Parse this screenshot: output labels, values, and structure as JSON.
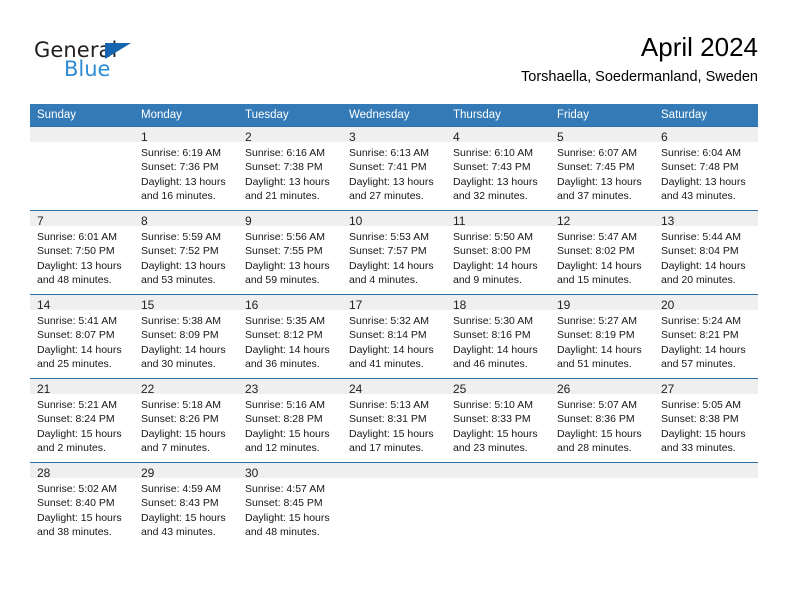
{
  "logo": {
    "word1": "General",
    "word2": "Blue",
    "triangle_color": "#1565b0",
    "word2_color": "#2e8bd4"
  },
  "header": {
    "title": "April 2024",
    "subtitle": "Torshaella, Soedermanland, Sweden"
  },
  "theme": {
    "header_bg": "#337ab7",
    "row_divider": "#2f6fa8",
    "daynum_bg": "#efefef"
  },
  "weekday_headers": [
    "Sunday",
    "Monday",
    "Tuesday",
    "Wednesday",
    "Thursday",
    "Friday",
    "Saturday"
  ],
  "weeks": [
    [
      {
        "day": "",
        "blank": true,
        "sunrise": "",
        "sunset": "",
        "daylight1": "",
        "daylight2": ""
      },
      {
        "day": "1",
        "blank": false,
        "sunrise": "Sunrise: 6:19 AM",
        "sunset": "Sunset: 7:36 PM",
        "daylight1": "Daylight: 13 hours",
        "daylight2": "and 16 minutes."
      },
      {
        "day": "2",
        "blank": false,
        "sunrise": "Sunrise: 6:16 AM",
        "sunset": "Sunset: 7:38 PM",
        "daylight1": "Daylight: 13 hours",
        "daylight2": "and 21 minutes."
      },
      {
        "day": "3",
        "blank": false,
        "sunrise": "Sunrise: 6:13 AM",
        "sunset": "Sunset: 7:41 PM",
        "daylight1": "Daylight: 13 hours",
        "daylight2": "and 27 minutes."
      },
      {
        "day": "4",
        "blank": false,
        "sunrise": "Sunrise: 6:10 AM",
        "sunset": "Sunset: 7:43 PM",
        "daylight1": "Daylight: 13 hours",
        "daylight2": "and 32 minutes."
      },
      {
        "day": "5",
        "blank": false,
        "sunrise": "Sunrise: 6:07 AM",
        "sunset": "Sunset: 7:45 PM",
        "daylight1": "Daylight: 13 hours",
        "daylight2": "and 37 minutes."
      },
      {
        "day": "6",
        "blank": false,
        "sunrise": "Sunrise: 6:04 AM",
        "sunset": "Sunset: 7:48 PM",
        "daylight1": "Daylight: 13 hours",
        "daylight2": "and 43 minutes."
      }
    ],
    [
      {
        "day": "7",
        "blank": false,
        "sunrise": "Sunrise: 6:01 AM",
        "sunset": "Sunset: 7:50 PM",
        "daylight1": "Daylight: 13 hours",
        "daylight2": "and 48 minutes."
      },
      {
        "day": "8",
        "blank": false,
        "sunrise": "Sunrise: 5:59 AM",
        "sunset": "Sunset: 7:52 PM",
        "daylight1": "Daylight: 13 hours",
        "daylight2": "and 53 minutes."
      },
      {
        "day": "9",
        "blank": false,
        "sunrise": "Sunrise: 5:56 AM",
        "sunset": "Sunset: 7:55 PM",
        "daylight1": "Daylight: 13 hours",
        "daylight2": "and 59 minutes."
      },
      {
        "day": "10",
        "blank": false,
        "sunrise": "Sunrise: 5:53 AM",
        "sunset": "Sunset: 7:57 PM",
        "daylight1": "Daylight: 14 hours",
        "daylight2": "and 4 minutes."
      },
      {
        "day": "11",
        "blank": false,
        "sunrise": "Sunrise: 5:50 AM",
        "sunset": "Sunset: 8:00 PM",
        "daylight1": "Daylight: 14 hours",
        "daylight2": "and 9 minutes."
      },
      {
        "day": "12",
        "blank": false,
        "sunrise": "Sunrise: 5:47 AM",
        "sunset": "Sunset: 8:02 PM",
        "daylight1": "Daylight: 14 hours",
        "daylight2": "and 15 minutes."
      },
      {
        "day": "13",
        "blank": false,
        "sunrise": "Sunrise: 5:44 AM",
        "sunset": "Sunset: 8:04 PM",
        "daylight1": "Daylight: 14 hours",
        "daylight2": "and 20 minutes."
      }
    ],
    [
      {
        "day": "14",
        "blank": false,
        "sunrise": "Sunrise: 5:41 AM",
        "sunset": "Sunset: 8:07 PM",
        "daylight1": "Daylight: 14 hours",
        "daylight2": "and 25 minutes."
      },
      {
        "day": "15",
        "blank": false,
        "sunrise": "Sunrise: 5:38 AM",
        "sunset": "Sunset: 8:09 PM",
        "daylight1": "Daylight: 14 hours",
        "daylight2": "and 30 minutes."
      },
      {
        "day": "16",
        "blank": false,
        "sunrise": "Sunrise: 5:35 AM",
        "sunset": "Sunset: 8:12 PM",
        "daylight1": "Daylight: 14 hours",
        "daylight2": "and 36 minutes."
      },
      {
        "day": "17",
        "blank": false,
        "sunrise": "Sunrise: 5:32 AM",
        "sunset": "Sunset: 8:14 PM",
        "daylight1": "Daylight: 14 hours",
        "daylight2": "and 41 minutes."
      },
      {
        "day": "18",
        "blank": false,
        "sunrise": "Sunrise: 5:30 AM",
        "sunset": "Sunset: 8:16 PM",
        "daylight1": "Daylight: 14 hours",
        "daylight2": "and 46 minutes."
      },
      {
        "day": "19",
        "blank": false,
        "sunrise": "Sunrise: 5:27 AM",
        "sunset": "Sunset: 8:19 PM",
        "daylight1": "Daylight: 14 hours",
        "daylight2": "and 51 minutes."
      },
      {
        "day": "20",
        "blank": false,
        "sunrise": "Sunrise: 5:24 AM",
        "sunset": "Sunset: 8:21 PM",
        "daylight1": "Daylight: 14 hours",
        "daylight2": "and 57 minutes."
      }
    ],
    [
      {
        "day": "21",
        "blank": false,
        "sunrise": "Sunrise: 5:21 AM",
        "sunset": "Sunset: 8:24 PM",
        "daylight1": "Daylight: 15 hours",
        "daylight2": "and 2 minutes."
      },
      {
        "day": "22",
        "blank": false,
        "sunrise": "Sunrise: 5:18 AM",
        "sunset": "Sunset: 8:26 PM",
        "daylight1": "Daylight: 15 hours",
        "daylight2": "and 7 minutes."
      },
      {
        "day": "23",
        "blank": false,
        "sunrise": "Sunrise: 5:16 AM",
        "sunset": "Sunset: 8:28 PM",
        "daylight1": "Daylight: 15 hours",
        "daylight2": "and 12 minutes."
      },
      {
        "day": "24",
        "blank": false,
        "sunrise": "Sunrise: 5:13 AM",
        "sunset": "Sunset: 8:31 PM",
        "daylight1": "Daylight: 15 hours",
        "daylight2": "and 17 minutes."
      },
      {
        "day": "25",
        "blank": false,
        "sunrise": "Sunrise: 5:10 AM",
        "sunset": "Sunset: 8:33 PM",
        "daylight1": "Daylight: 15 hours",
        "daylight2": "and 23 minutes."
      },
      {
        "day": "26",
        "blank": false,
        "sunrise": "Sunrise: 5:07 AM",
        "sunset": "Sunset: 8:36 PM",
        "daylight1": "Daylight: 15 hours",
        "daylight2": "and 28 minutes."
      },
      {
        "day": "27",
        "blank": false,
        "sunrise": "Sunrise: 5:05 AM",
        "sunset": "Sunset: 8:38 PM",
        "daylight1": "Daylight: 15 hours",
        "daylight2": "and 33 minutes."
      }
    ],
    [
      {
        "day": "28",
        "blank": false,
        "sunrise": "Sunrise: 5:02 AM",
        "sunset": "Sunset: 8:40 PM",
        "daylight1": "Daylight: 15 hours",
        "daylight2": "and 38 minutes."
      },
      {
        "day": "29",
        "blank": false,
        "sunrise": "Sunrise: 4:59 AM",
        "sunset": "Sunset: 8:43 PM",
        "daylight1": "Daylight: 15 hours",
        "daylight2": "and 43 minutes."
      },
      {
        "day": "30",
        "blank": false,
        "sunrise": "Sunrise: 4:57 AM",
        "sunset": "Sunset: 8:45 PM",
        "daylight1": "Daylight: 15 hours",
        "daylight2": "and 48 minutes."
      },
      {
        "day": "",
        "blank": true,
        "sunrise": "",
        "sunset": "",
        "daylight1": "",
        "daylight2": ""
      },
      {
        "day": "",
        "blank": true,
        "sunrise": "",
        "sunset": "",
        "daylight1": "",
        "daylight2": ""
      },
      {
        "day": "",
        "blank": true,
        "sunrise": "",
        "sunset": "",
        "daylight1": "",
        "daylight2": ""
      },
      {
        "day": "",
        "blank": true,
        "sunrise": "",
        "sunset": "",
        "daylight1": "",
        "daylight2": ""
      }
    ]
  ]
}
